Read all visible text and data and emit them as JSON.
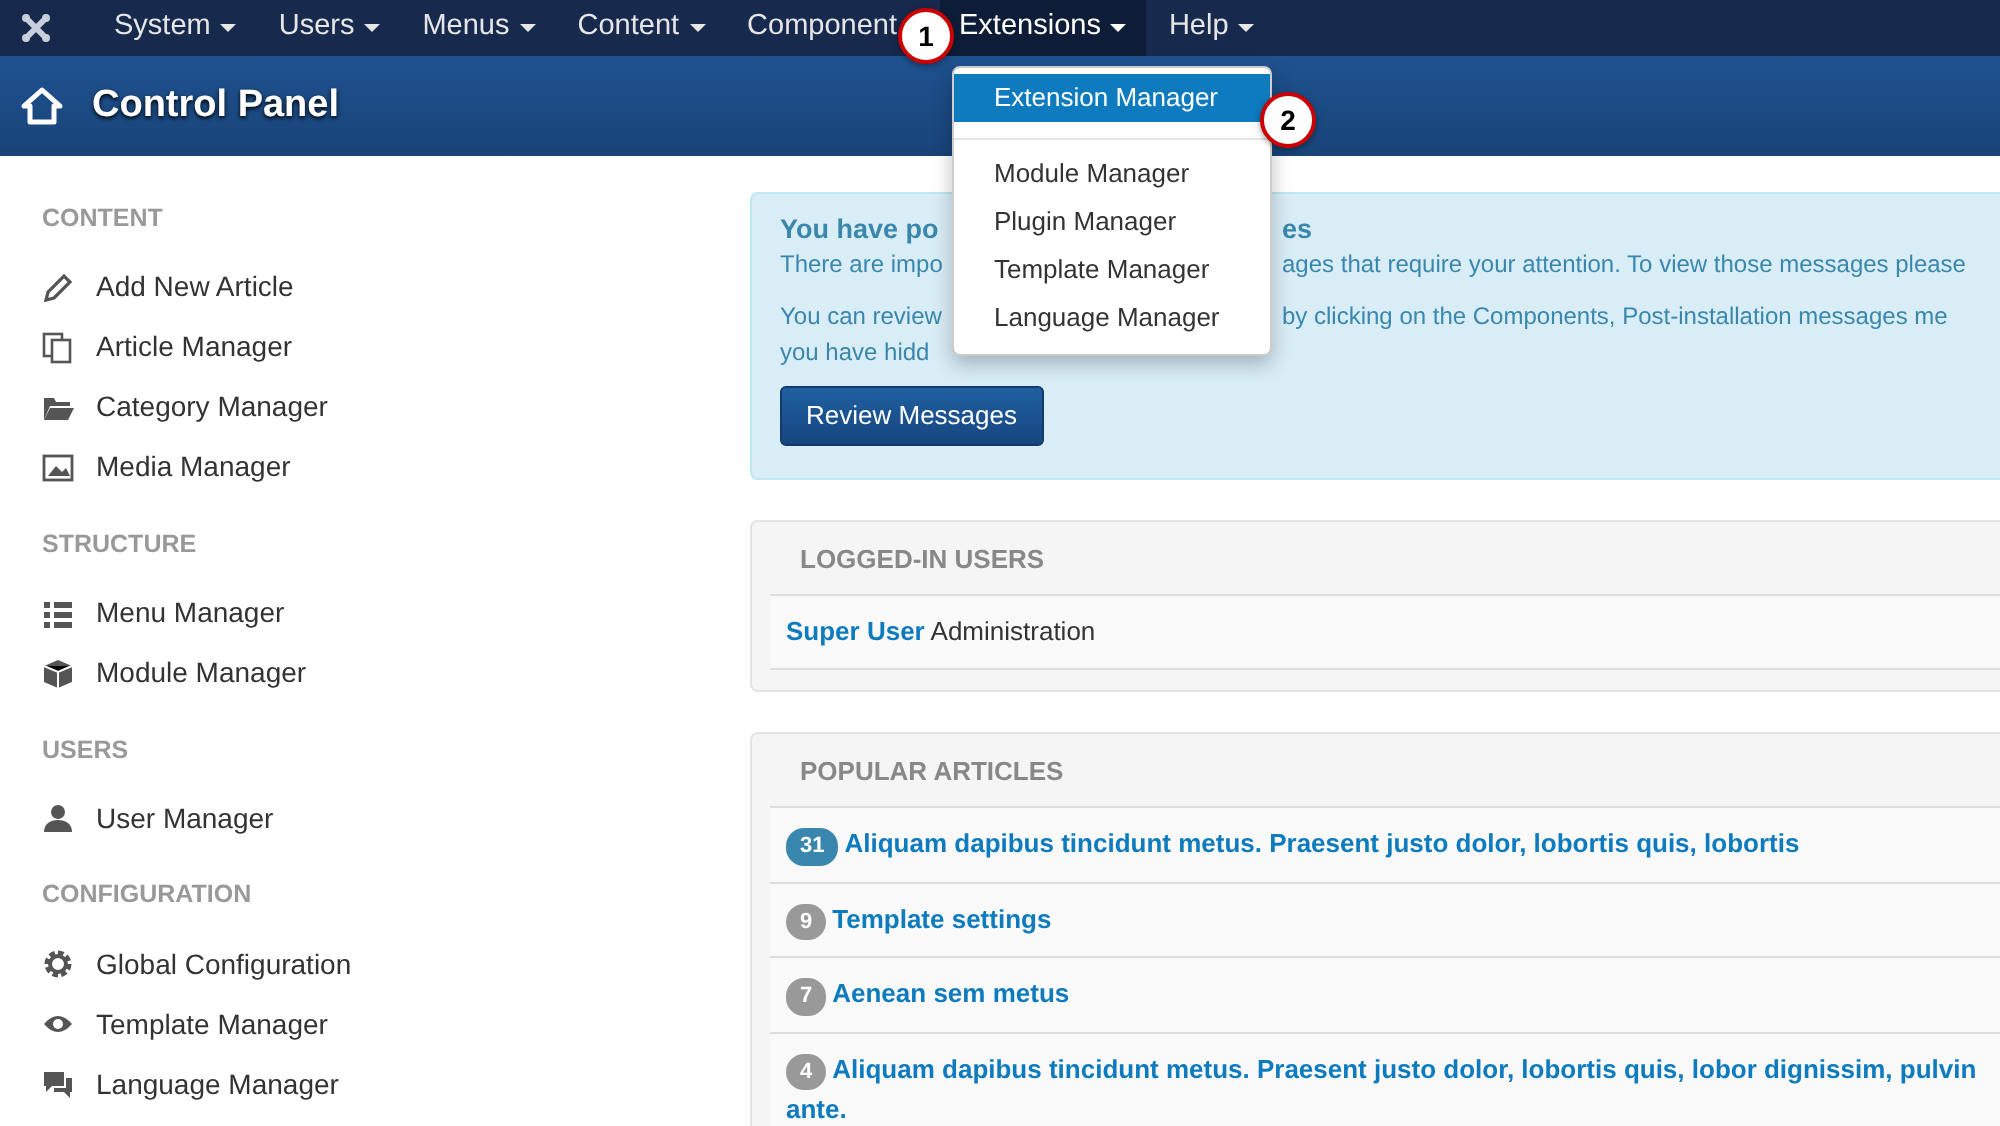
{
  "menubar": {
    "items": [
      {
        "label": "System",
        "selected": false
      },
      {
        "label": "Users",
        "selected": false
      },
      {
        "label": "Menus",
        "selected": false
      },
      {
        "label": "Content",
        "selected": false
      },
      {
        "label": "Component",
        "selected": false,
        "caret": false
      },
      {
        "label": "Extensions",
        "selected": true
      },
      {
        "label": "Help",
        "selected": false
      }
    ]
  },
  "header": {
    "title": "Control Panel"
  },
  "dropdown": {
    "items": [
      {
        "label": "Extension Manager",
        "selected": true,
        "kind": "item"
      },
      {
        "kind": "divider"
      },
      {
        "label": "Module Manager",
        "selected": false,
        "kind": "item"
      },
      {
        "label": "Plugin Manager",
        "selected": false,
        "kind": "item"
      },
      {
        "label": "Template Manager",
        "selected": false,
        "kind": "item"
      },
      {
        "label": "Language Manager",
        "selected": false,
        "kind": "item"
      }
    ]
  },
  "callouts": [
    "1",
    "2"
  ],
  "sidebar": {
    "sections": [
      {
        "heading": "CONTENT",
        "items": [
          "Add New Article",
          "Article Manager",
          "Category Manager",
          "Media Manager"
        ]
      },
      {
        "heading": "STRUCTURE",
        "items": [
          "Menu Manager",
          "Module Manager"
        ]
      },
      {
        "heading": "USERS",
        "items": [
          "User Manager"
        ]
      },
      {
        "heading": "CONFIGURATION",
        "items": [
          "Global Configuration",
          "Template Manager",
          "Language Manager"
        ]
      }
    ]
  },
  "alert": {
    "title_parts": [
      "You have po",
      "es"
    ],
    "line_1_parts": [
      "There are impo",
      "ages that require your attention. To view those messages please"
    ],
    "line_2_parts": [
      "You can review",
      "by clicking on the Components, Post-installation messages me"
    ],
    "line_3_parts": [
      "you have hidd"
    ],
    "button": "Review Messages"
  },
  "logged_in": {
    "heading": "LOGGED-IN USERS",
    "rows": [
      {
        "name": "Super User",
        "area": "Administration"
      }
    ]
  },
  "popular": {
    "heading": "POPULAR ARTICLES",
    "rows": [
      {
        "hits": "31",
        "color": "#3a87ad",
        "title": "Aliquam dapibus tincidunt metus. Praesent justo dolor, lobortis quis, lobortis"
      },
      {
        "hits": "9",
        "color": "#999999",
        "title": "Template settings"
      },
      {
        "hits": "7",
        "color": "#999999",
        "title": "Aenean sem metus"
      },
      {
        "hits": "4",
        "color": "#999999",
        "title": "Aliquam dapibus tincidunt metus. Praesent justo dolor, lobortis quis, lobor dignissim, pulvin",
        "continuation": "ante."
      }
    ]
  }
}
